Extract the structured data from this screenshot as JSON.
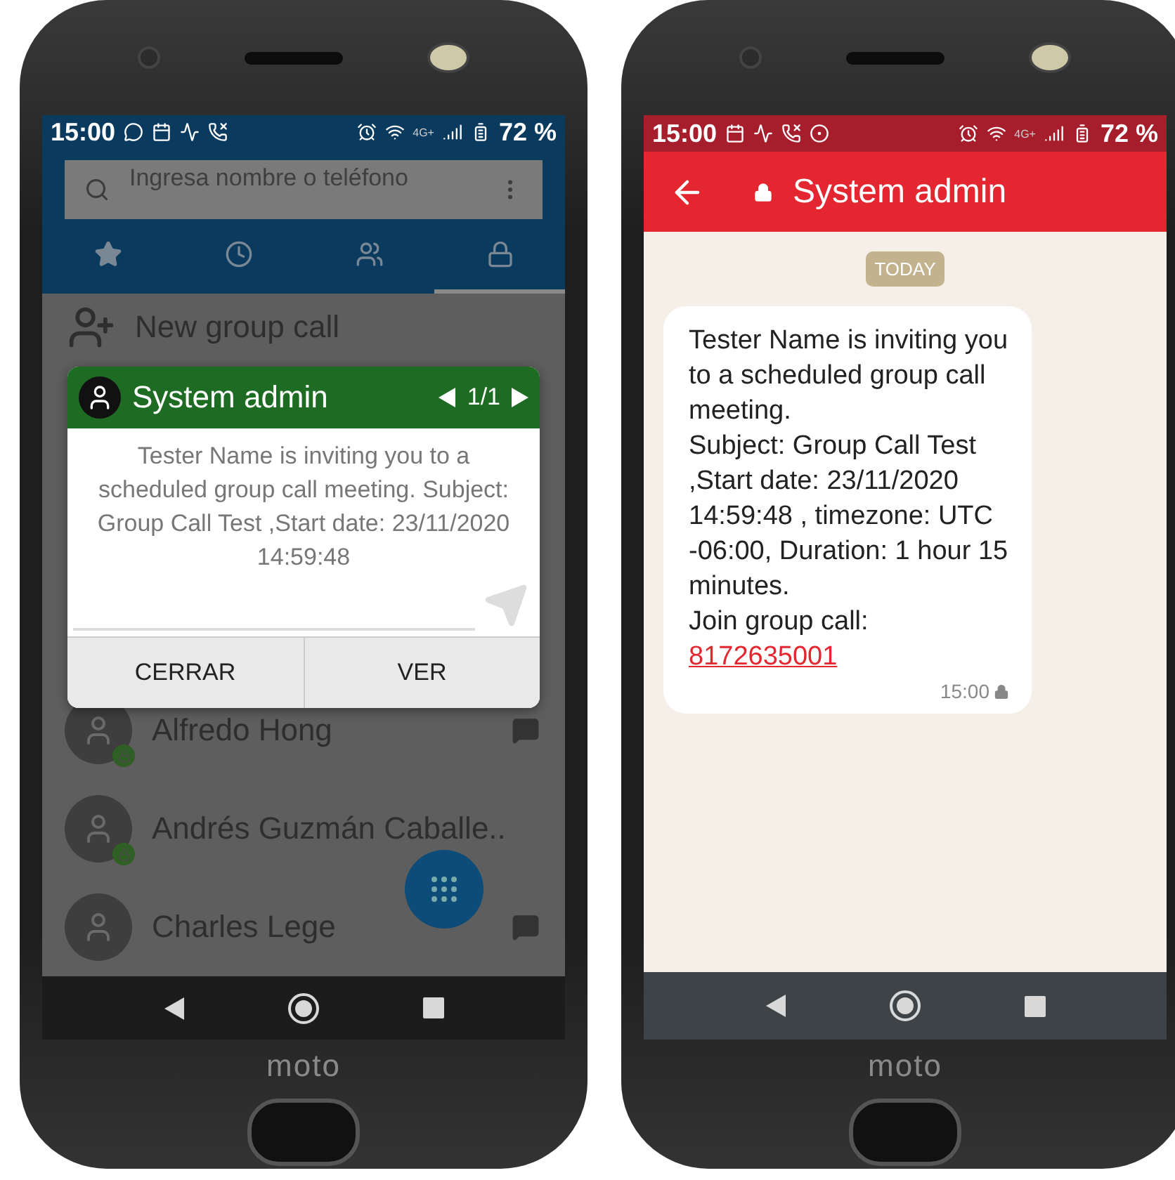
{
  "phones": [
    {
      "kind": "contacts",
      "status_bar": {
        "time": "15:00",
        "network": "4G+",
        "battery": "72 %"
      },
      "search": {
        "placeholder": "Ingresa nombre o teléfono"
      },
      "tabs": [
        {
          "selected": false
        },
        {
          "selected": false
        },
        {
          "selected": false
        },
        {
          "selected": true
        }
      ],
      "new_group": "New group call",
      "contacts": [
        {
          "name": "Alfredo Hong",
          "secure": true
        },
        {
          "name": "Andrés Guzmán Caballe..",
          "secure": true
        },
        {
          "name": "Charles Lege",
          "secure": false
        }
      ],
      "dialog": {
        "title": "System admin",
        "pager": "1/1",
        "message": "Tester Name is inviting you to a scheduled group call meeting. Subject: Group Call Test ,Start date: 23/11/2020 14:59:48",
        "buttons": [
          "CERRAR",
          "VER"
        ]
      },
      "brand": "moto"
    },
    {
      "kind": "chat",
      "status_bar": {
        "time": "15:00",
        "network": "4G+",
        "battery": "72 %"
      },
      "title": "System admin",
      "date_chip": "TODAY",
      "message": {
        "lines": [
          "Tester Name is inviting you to a scheduled group call meeting.",
          "Subject: Group Call Test ,Start date: 23/11/2020 14:59:48 , timezone: UTC -06:00, Duration: 1 hour 15 minutes.",
          "Join group call:"
        ],
        "link": "8172635001",
        "time": "15:00"
      },
      "brand": "moto"
    }
  ]
}
